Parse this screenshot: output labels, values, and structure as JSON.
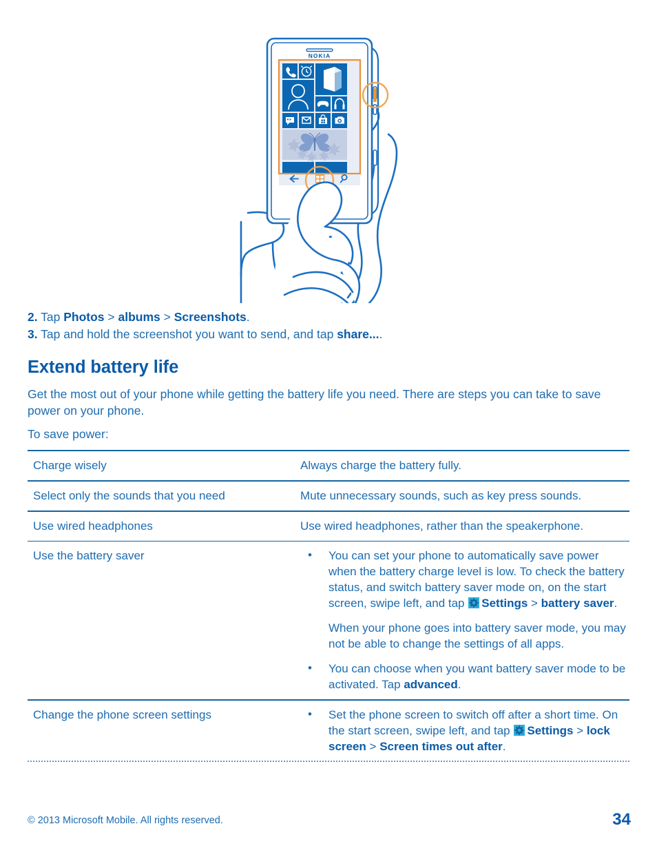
{
  "illustration": {
    "alt": "Hand holding a Nokia Lumia phone, pressing the start key and the side key to take a screenshot",
    "phone_brand": "NOKIA",
    "tiles": [
      "phone-tile",
      "alarm-clock-tile",
      "office-tile",
      "people-tile",
      "games-tile",
      "music-headphones-tile",
      "messaging-tile",
      "email-tile",
      "store-tile",
      "camera-tile",
      "photos-butterfly-tile"
    ],
    "nav_keys": [
      "back-key",
      "start-key",
      "search-key"
    ],
    "highlights": [
      "side-power-key-highlight",
      "start-key-highlight"
    ]
  },
  "steps": [
    {
      "number": "2.",
      "parts": [
        {
          "text": " Tap ",
          "bold": false
        },
        {
          "text": "Photos",
          "bold": true
        },
        {
          "text": " > ",
          "bold": false
        },
        {
          "text": "albums",
          "bold": true
        },
        {
          "text": " > ",
          "bold": false
        },
        {
          "text": "Screenshots",
          "bold": true
        },
        {
          "text": ".",
          "bold": false
        }
      ]
    },
    {
      "number": "3.",
      "parts": [
        {
          "text": " Tap and hold the screenshot you want to send, and tap ",
          "bold": false
        },
        {
          "text": "share...",
          "bold": true
        },
        {
          "text": ".",
          "bold": false
        }
      ]
    }
  ],
  "section": {
    "title": "Extend battery life",
    "intro": "Get the most out of your phone while getting the battery life you need. There are steps you can take to save power on your phone.",
    "lead": "To save power:"
  },
  "table": {
    "rows": [
      {
        "label": "Charge wisely",
        "body_text": "Always charge the battery fully."
      },
      {
        "label": "Select only the sounds that you need",
        "body_text": "Mute unnecessary sounds, such as key press sounds."
      },
      {
        "label": "Use wired headphones",
        "body_text": "Use wired headphones, rather than the speakerphone."
      },
      {
        "label": "Use the battery saver",
        "bullets": [
          {
            "paragraphs": [
              [
                {
                  "text": "You can set your phone to automatically save power when the battery charge level is low. To check the battery status, and switch battery saver mode on, on the start screen, swipe left, and tap ",
                  "bold": false
                },
                {
                  "icon": "settings-gear-icon"
                },
                {
                  "text": "Settings",
                  "bold": true
                },
                {
                  "text": " > ",
                  "bold": false
                },
                {
                  "text": "battery saver",
                  "bold": true
                },
                {
                  "text": ".",
                  "bold": false
                }
              ],
              [
                {
                  "text": "When your phone goes into battery saver mode, you may not be able to change the settings of all apps.",
                  "bold": false
                }
              ]
            ]
          },
          {
            "paragraphs": [
              [
                {
                  "text": "You can choose when you want battery saver mode to be activated. Tap ",
                  "bold": false
                },
                {
                  "text": "advanced",
                  "bold": true
                },
                {
                  "text": ".",
                  "bold": false
                }
              ]
            ]
          }
        ]
      },
      {
        "label": "Change the phone screen settings",
        "bullets": [
          {
            "paragraphs": [
              [
                {
                  "text": "Set the phone screen to switch off after a short time. On the start screen, swipe left, and tap ",
                  "bold": false
                },
                {
                  "icon": "settings-gear-icon"
                },
                {
                  "text": "Settings",
                  "bold": true
                },
                {
                  "text": " > ",
                  "bold": false
                },
                {
                  "text": "lock screen",
                  "bold": true
                },
                {
                  "text": " > ",
                  "bold": false
                },
                {
                  "text": "Screen times out after",
                  "bold": true
                },
                {
                  "text": ".",
                  "bold": false
                }
              ]
            ]
          }
        ]
      }
    ]
  },
  "footer": {
    "copyright": "© 2013 Microsoft Mobile. All rights reserved.",
    "page_number": "34"
  },
  "colors": {
    "body_blue": "#1d6cb0",
    "bold_blue": "#0a5ba8",
    "rule_blue": "#15659f",
    "tile_blue": "#0b67b2",
    "screen_bg": "#e9edf5",
    "highlight_orange": "#f0972c",
    "outline_blue": "#1b6fc0"
  }
}
